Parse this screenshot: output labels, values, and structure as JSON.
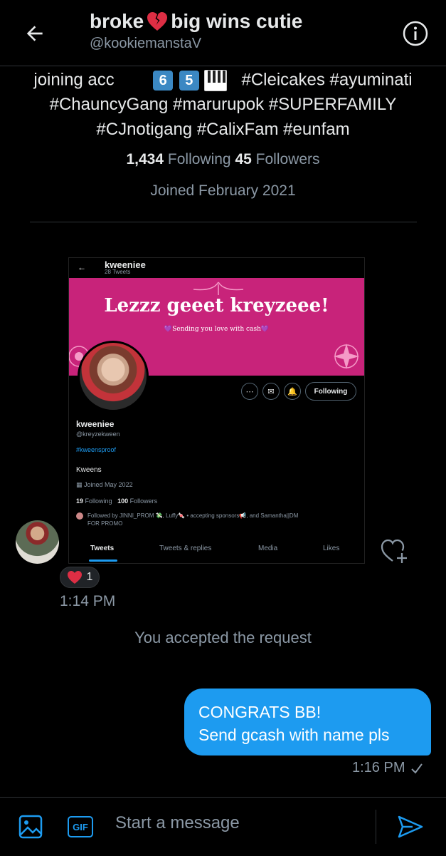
{
  "header": {
    "name": "broke",
    "name_suffix": "big wins cutie",
    "handle": "@kookiemanstaV",
    "icons": {
      "back": "arrow-left-icon",
      "info": "info-icon",
      "emoji": "broken-heart"
    }
  },
  "bio": {
    "line1_left": "joining acc",
    "line1_keycaps": [
      "6",
      "5"
    ],
    "line1_right": "#Cleicakes #ayuminati",
    "line2": "#ChauncyGang #marurupok #SUPERFAMILY",
    "line3": "#CJnotigang #CalixFam #eunfam"
  },
  "stats": {
    "following_count": "1,434",
    "following_label": "Following",
    "followers_count": "45",
    "followers_label": "Followers"
  },
  "joined": "Joined February 2021",
  "shared_card": {
    "title": "kweeniee",
    "tweet_count": "28 Tweets",
    "banner_title": "Lezzz geeet kreyzeee!",
    "banner_sub": "💜Sending you love with cash💜",
    "following_button": "Following",
    "name": "kweeniee",
    "handle": "@kreyzekween",
    "hashtag": "#kweensproof",
    "bio": "Kweens",
    "joined": "Joined May 2022",
    "following_count": "19",
    "following_label": "Following",
    "followers_count": "100",
    "followers_label": "Followers",
    "followed_by": "Followed by JINNI_PROM 💸, Luffy🍬 • accepting sponsors📢, and Samantha||DM FOR PROMO",
    "tabs": [
      "Tweets",
      "Tweets & replies",
      "Media",
      "Likes"
    ]
  },
  "reaction": {
    "emoji": "❤️",
    "count": "1"
  },
  "received_time": "1:14 PM",
  "system_message": "You accepted the request",
  "sent_message": {
    "line1": "CONGRATS BB!",
    "line2": "Send gcash with name pls",
    "time": "1:16 PM"
  },
  "composer": {
    "placeholder": "Start a message",
    "gif_label": "GIF"
  },
  "colors": {
    "accent": "#1d9bf0",
    "banner": "#c8237a",
    "muted": "#8b98a5"
  }
}
